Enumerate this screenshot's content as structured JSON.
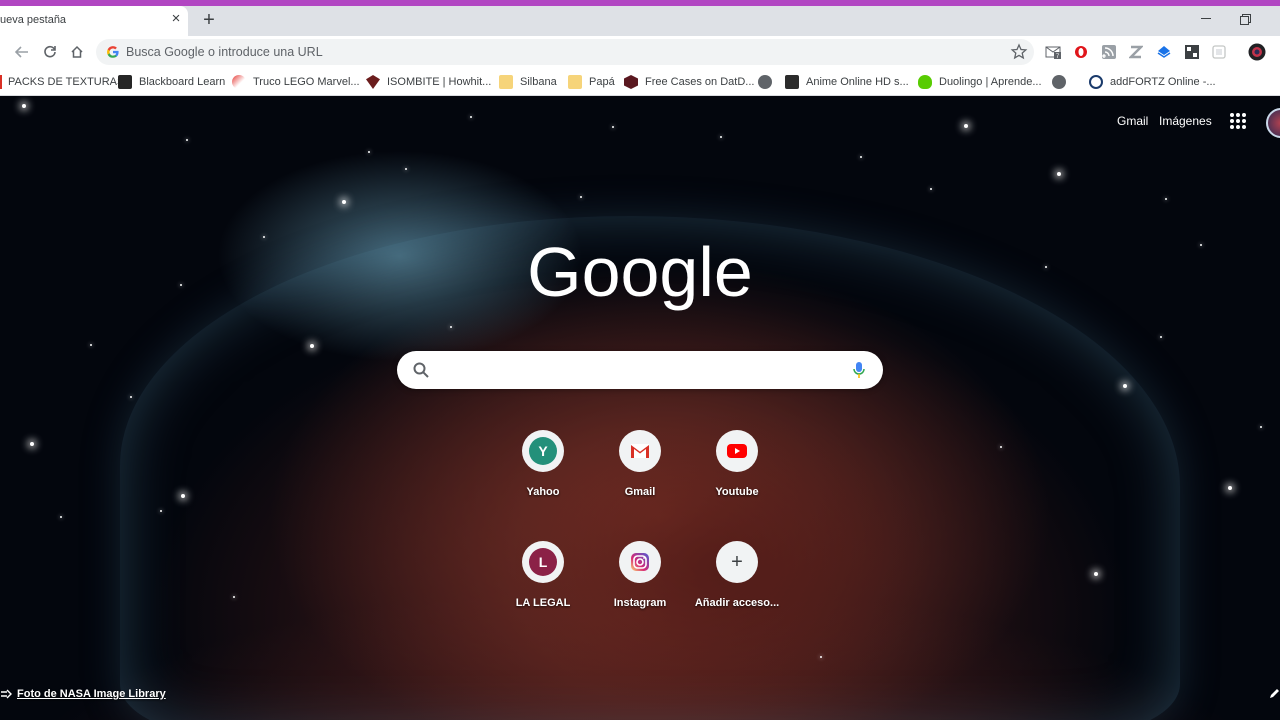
{
  "browser": {
    "accent_color": "#b146c2",
    "tab": {
      "title": "ueva pestaña"
    },
    "omnibox": {
      "placeholder": "Busca Google o introduce una URL"
    }
  },
  "bookmarks": [
    {
      "label": "PACKS DE TEXTURAS",
      "icon": "bookmark-icon"
    },
    {
      "label": "Blackboard Learn",
      "icon": "blackboard-icon"
    },
    {
      "label": "Truco LEGO Marvel...",
      "icon": "site-icon"
    },
    {
      "label": "ISOMBITE | Howhit...",
      "icon": "site-icon"
    },
    {
      "label": "Silbana",
      "icon": "folder-icon"
    },
    {
      "label": "Papá",
      "icon": "folder-icon"
    },
    {
      "label": "Free Cases on DatD...",
      "icon": "site-icon"
    },
    {
      "label": "",
      "icon": "globe-icon"
    },
    {
      "label": "Anime Online HD s...",
      "icon": "site-icon"
    },
    {
      "label": "Duolingo | Aprende...",
      "icon": "duolingo-icon"
    },
    {
      "label": "",
      "icon": "globe-icon"
    },
    {
      "label": "addFORTZ Online -...",
      "icon": "site-icon"
    }
  ],
  "ntp": {
    "gmail_link": "Gmail",
    "images_link": "Imágenes",
    "logo_text": "Google",
    "search": {
      "placeholder": ""
    },
    "shortcuts": [
      {
        "label": "Yahoo",
        "letter": "Y",
        "color": "#23907a"
      },
      {
        "label": "Gmail",
        "letter": "",
        "color": "#d93025"
      },
      {
        "label": "Youtube",
        "letter": "",
        "color": "#ff0000"
      },
      {
        "label": "LA LEGAL",
        "letter": "L",
        "color": "#8b2147"
      },
      {
        "label": "Instagram",
        "letter": "",
        "color": "#c13584"
      },
      {
        "label": "Añadir acceso...",
        "letter": "+",
        "color": "#3c4043"
      }
    ],
    "photo_credit": "Foto de NASA Image Library"
  }
}
